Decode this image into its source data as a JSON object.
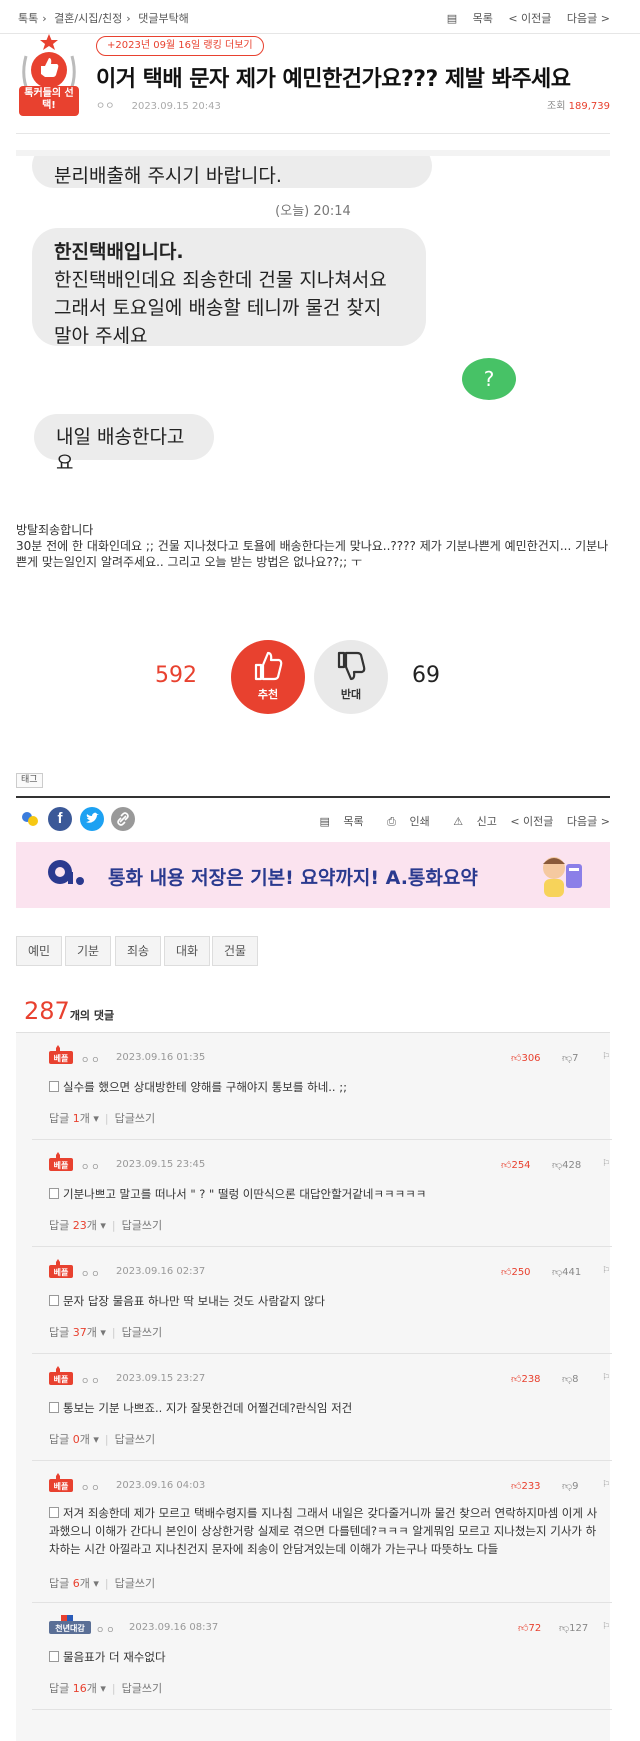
{
  "nav": {
    "breadcrumbs": [
      "톡톡",
      "결혼/시집/친정",
      "댓글부탁해"
    ],
    "list_label": "목록",
    "prev_label": "< 이전글",
    "next_label": "다음글 >"
  },
  "post": {
    "badge_text": "톡커들의 선택!",
    "ranking_pill": "+2023년 09월 16일 랭킹 더보기",
    "title": "이거 택배 문자 제가 예민한건가요??? 제발 봐주세요",
    "author_dots": "ㅇㅇ",
    "date": "2023.09.15 20:43",
    "views_label": "조회",
    "views": "189,739",
    "chat": {
      "prev_msg": "분리배출해 주시기 바랍니다.",
      "time": "(오늘) 20:14",
      "msg1_title": "한진택배입니다.",
      "msg1_body": "한진택배인데요 죄송한데 건물 지나쳐서요 그래서 토요일에 배송할 테니까 물건 찾지 말아 주세요",
      "reply": "?",
      "msg2": "내일 배송한다고요"
    },
    "body_line1": "방탈죄송합니다",
    "body_line2": "30분 전에 한 대화인데요 ;; 건물 지나쳤다고 토욜에 배송한다는게 맞나요..???? 제가 기분나쁜게 예민한건지... 기분나쁜게 맞는일인지 알려주세요.. 그리고 오늘 받는 방법은 없나요??;; ㅜ"
  },
  "votes": {
    "up_count": "592",
    "up_label": "추천",
    "down_count": "69",
    "down_label": "반대"
  },
  "tag_label": "태그",
  "tools": {
    "list": "목록",
    "print": "인쇄",
    "report": "신고",
    "prev": "< 이전글",
    "next": "다음글 >"
  },
  "ad": {
    "text": "통화 내용 저장은 기본! 요약까지! A.통화요약"
  },
  "keywords": [
    "예민",
    "기분",
    "죄송",
    "대화",
    "건물"
  ],
  "comments_header": {
    "count": "287",
    "label": "개의 댓글"
  },
  "comments": [
    {
      "badge": "베플",
      "author": "ㅇㅇ",
      "date": "2023.09.16 01:35",
      "up": "306",
      "down": "7",
      "text": "실수를 했으면 상대방한테 양해를 구해야지 통보를 하네.. ;;",
      "reply_prefix": "답글",
      "reply_count": "1",
      "reply_unit": "개",
      "write": "답글쓰기"
    },
    {
      "badge": "베플",
      "author": "ㅇㅇ",
      "date": "2023.09.15 23:45",
      "up": "254",
      "down": "428",
      "text": "기분나쁘고 말고를 떠나서 \" ? \" 떨렁 이딴식으론 대답안할거같네ㅋㅋㅋㅋㅋ",
      "reply_prefix": "답글",
      "reply_count": "23",
      "reply_unit": "개",
      "write": "답글쓰기"
    },
    {
      "badge": "베플",
      "author": "ㅇㅇ",
      "date": "2023.09.16 02:37",
      "up": "250",
      "down": "441",
      "text": "문자 답장 물음표 하나만 딱 보내는 것도 사람같지 않다",
      "reply_prefix": "답글",
      "reply_count": "37",
      "reply_unit": "개",
      "write": "답글쓰기"
    },
    {
      "badge": "베플",
      "author": "ㅇㅇ",
      "date": "2023.09.15 23:27",
      "up": "238",
      "down": "8",
      "text": "통보는 기분 나쁘죠.. 지가 잘못한건데 어쩔건데?란식임 저건",
      "reply_prefix": "답글",
      "reply_count": "0",
      "reply_unit": "개",
      "write": "답글쓰기"
    },
    {
      "badge": "베플",
      "author": "ㅇㅇ",
      "date": "2023.09.16 04:03",
      "up": "233",
      "down": "9",
      "text": "저겨 죄송한데 제가 모르고 택배수령지를 지나침 그래서 내일은 갖다줄거니까 물건 찾으러 연락하지마셈 이게 사과했으니 이해가 간다니 본인이 상상한거랑 실제로 겪으면 다를텐데?ㅋㅋㅋ 알게뭐임 모르고 지나쳤는지 기사가 하차하는 시간 아낄라고 지나친건지 문자에 죄송이 안담겨있는데 이해가 가는구나 따뜻하노 다들",
      "reply_prefix": "답글",
      "reply_count": "6",
      "reply_unit": "개",
      "write": "답글쓰기"
    },
    {
      "badge": "천년대감",
      "author": "ㅇㅇ",
      "date": "2023.09.16 08:37",
      "up": "72",
      "down": "127",
      "text": "물음표가 더 재수없다",
      "reply_prefix": "답글",
      "reply_count": "16",
      "reply_unit": "개",
      "write": "답글쓰기"
    }
  ],
  "colors": {
    "accent": "#e8412f",
    "chat_green": "#47c266",
    "chat_gray": "#ececec",
    "ad_bg": "#fbe3ef",
    "ad_text": "#2a3a8f",
    "facebook": "#3b5998",
    "twitter": "#1da1f2"
  }
}
